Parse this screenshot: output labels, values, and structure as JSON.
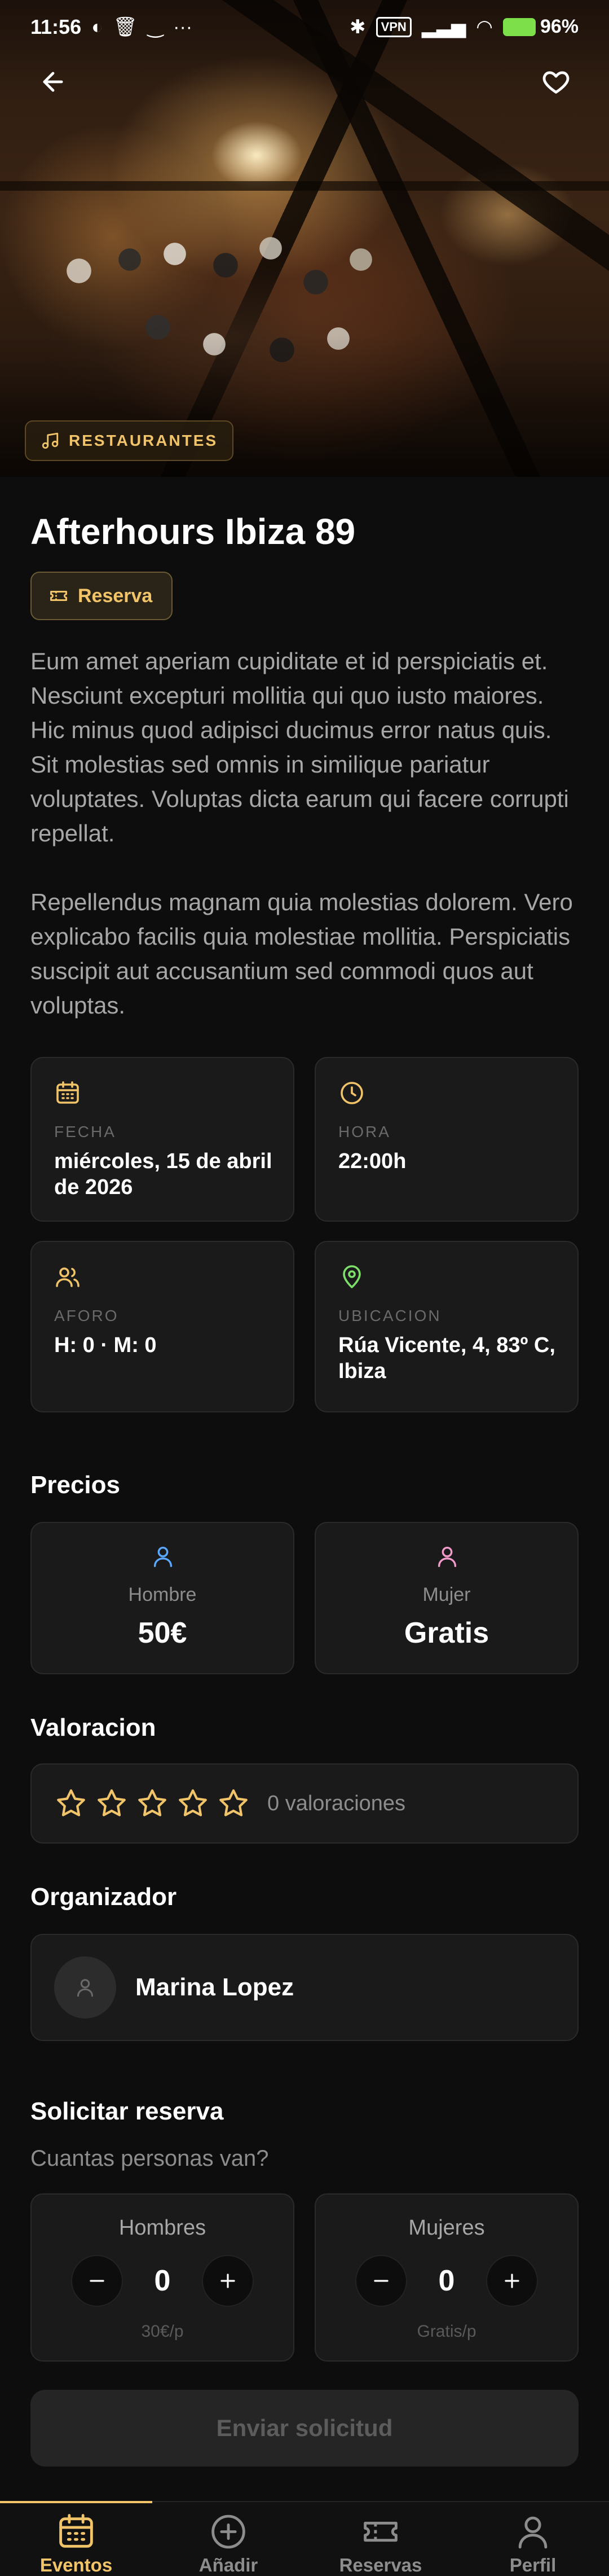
{
  "status_bar": {
    "time": "11:56",
    "vpn": "VPN",
    "battery": "96%"
  },
  "hero": {
    "category": "RESTAURANTES"
  },
  "event": {
    "title": "Afterhours Ibiza 89",
    "type": "Reserva",
    "description": [
      "Eum amet aperiam cupiditate et id perspiciatis et. Nesciunt excepturi mollitia qui quo iusto maiores. Hic minus quod adipisci ducimus error natus quis. Sit molestias sed omnis in similique pariatur voluptates. Voluptas dicta earum qui facere corrupti repellat.",
      "Repellendus magnam quia molestias dolorem. Vero explicabo facilis quia molestiae mollitia. Perspiciatis suscipit aut accusantium sed commodi quos aut voluptas."
    ]
  },
  "info": {
    "fecha_label": "FECHA",
    "fecha_value": "miércoles, 15 de abril de 2026",
    "hora_label": "HORA",
    "hora_value": "22:00h",
    "aforo_label": "AFORO",
    "aforo_value": "H: 0 · M: 0",
    "ubicacion_label": "UBICACION",
    "ubicacion_value": "Rúa Vicente, 4, 83º C, Ibiza"
  },
  "prices": {
    "title": "Precios",
    "men_label": "Hombre",
    "men_value": "50€",
    "women_label": "Mujer",
    "women_value": "Gratis"
  },
  "rating": {
    "title": "Valoracion",
    "count_text": "0 valoraciones"
  },
  "organizer": {
    "title": "Organizador",
    "name": "Marina Lopez"
  },
  "reservation": {
    "title": "Solicitar reserva",
    "subtitle": "Cuantas personas van?",
    "men_label": "Hombres",
    "men_count": "0",
    "men_price": "30€/p",
    "women_label": "Mujeres",
    "women_count": "0",
    "women_price": "Gratis/p",
    "submit": "Enviar solicitud"
  },
  "nav": {
    "items": [
      {
        "label": "Eventos",
        "icon": "calendar-icon",
        "active": true
      },
      {
        "label": "Añadir",
        "icon": "plus-circle-icon",
        "active": false
      },
      {
        "label": "Reservas",
        "icon": "ticket-icon",
        "active": false
      },
      {
        "label": "Perfil",
        "icon": "user-icon",
        "active": false
      }
    ]
  },
  "colors": {
    "accent": "#f2c46a",
    "background": "#0d0d0d",
    "card": "#1a1a1a",
    "location_green": "#7ddf6a",
    "men_blue": "#5aa8ff",
    "women_pink": "#f29ac8"
  }
}
